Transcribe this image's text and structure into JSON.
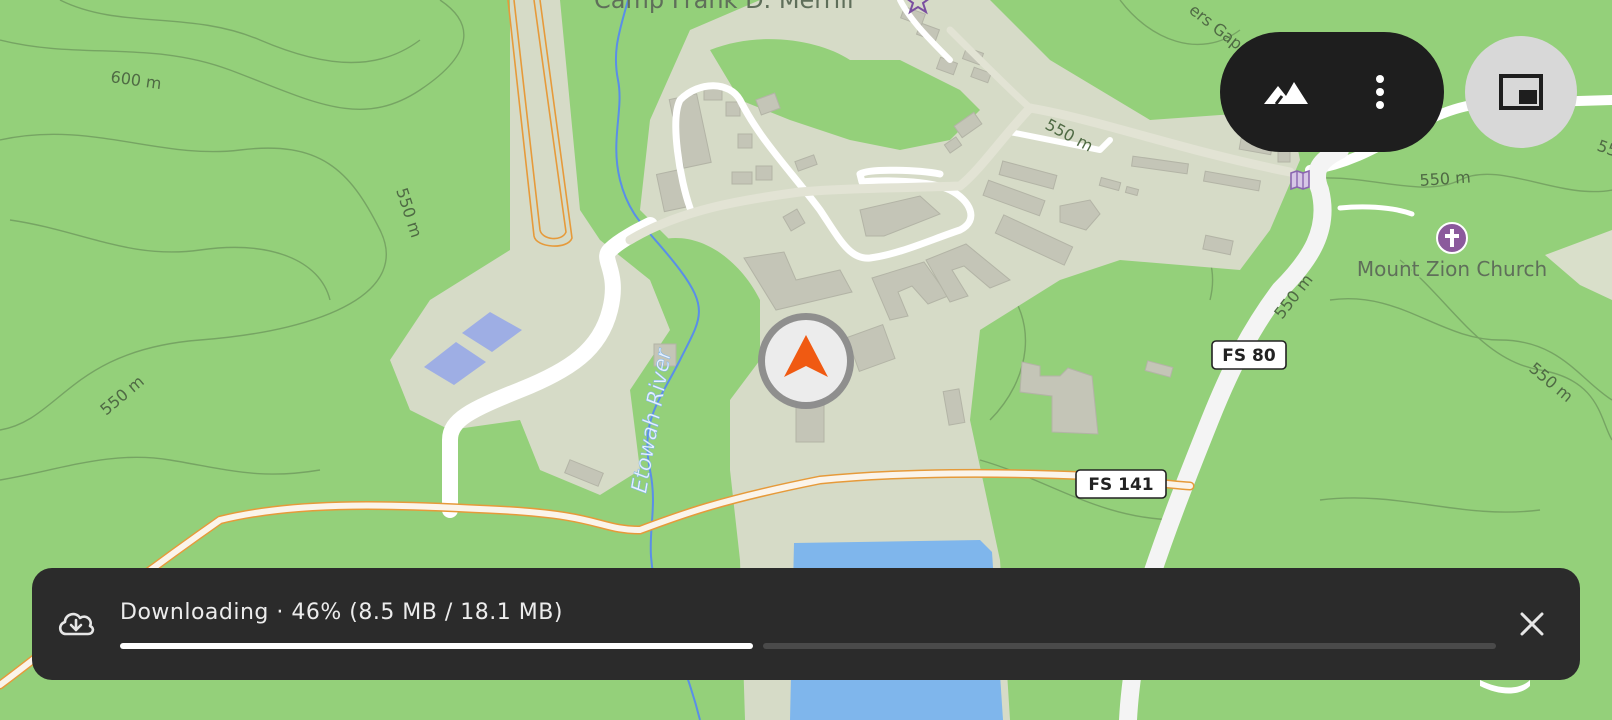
{
  "map": {
    "places": {
      "camp_label": "Camp Frank D. Merrill",
      "church": "Mount Zion Church",
      "gap_label": "ers Gap"
    },
    "water": {
      "river": "Etowah River"
    },
    "roads": {
      "fs80": "FS 80",
      "fs141": "FS 141"
    },
    "contours": {
      "c600": "600 m",
      "c550_a": "550 m",
      "c550_b": "550 m",
      "c550_c": "550 m",
      "c550_d": "550 m",
      "c550_e": "550 m",
      "c550_f": "550 m",
      "c550_edge": "55"
    },
    "icons": {
      "user_location": "navigation-arrow-icon",
      "church": "cross-icon",
      "camp": "star-icon",
      "trailhead": "map-icon"
    },
    "colors": {
      "land": "#94d07a",
      "developed": "#d6dbc7",
      "water": "#7fb6ec",
      "accent_arrow": "#f05a12"
    }
  },
  "controls": {
    "terrain_icon": "terrain-icon",
    "more_icon": "more-vert-icon",
    "pip_icon": "picture-in-picture-icon"
  },
  "download": {
    "status": "Downloading · 46% (8.5 MB / 18.1 MB)",
    "progress": 0.46,
    "icon": "cloud-download-icon",
    "close_icon": "close-icon"
  }
}
